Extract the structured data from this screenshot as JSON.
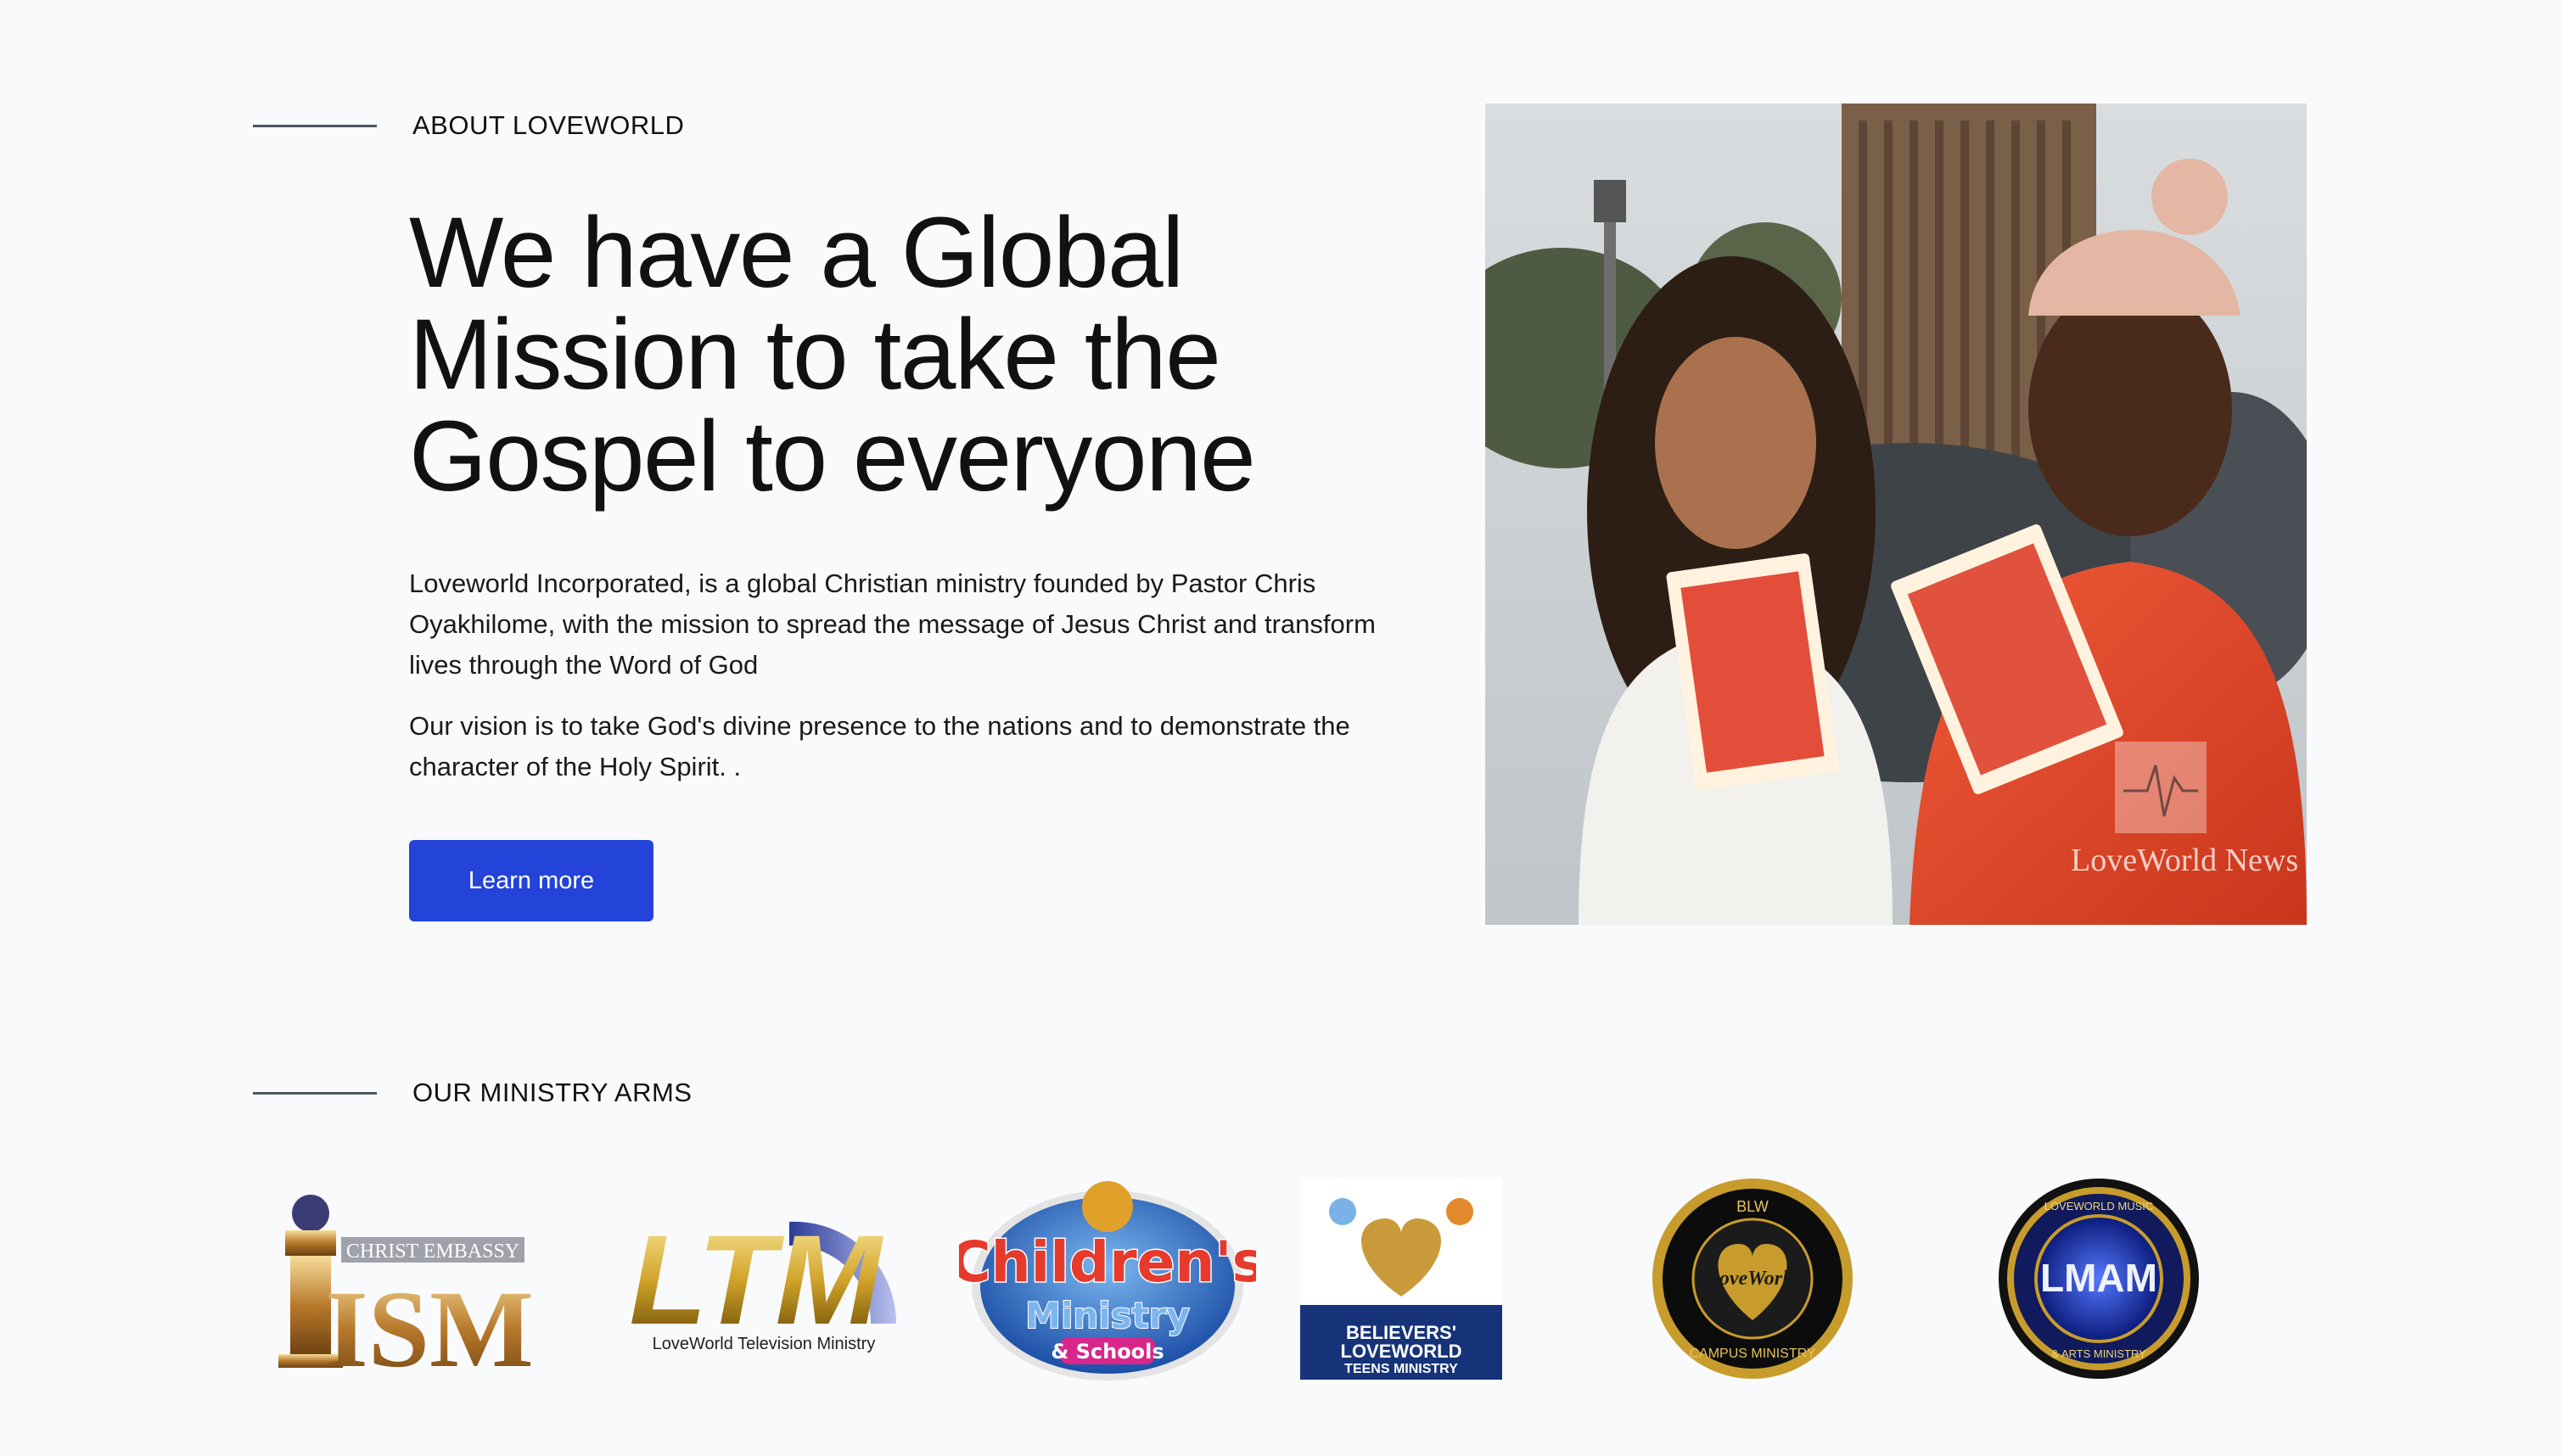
{
  "about": {
    "eyebrow": "ABOUT LOVEWORLD",
    "headline": "We have a Global Mission to take the Gospel to everyone",
    "paragraph1": "Loveworld Incorporated, is a global Christian ministry founded by Pastor Chris Oyakhilome, with the mission to spread the message of Jesus Christ and transform lives through the Word of God",
    "paragraph2": "Our vision is to take God's divine presence to the nations and to demonstrate the character of the Holy Spirit. .",
    "button_label": "Learn more",
    "button_color": "#2443d9",
    "photo": {
      "description": "two young women smiling holding Rhapsody of Realities booklets",
      "watermark": "LoveWorld News"
    }
  },
  "ministry_arms": {
    "eyebrow": "OUR MINISTRY ARMS",
    "logos": [
      {
        "name": "ISM",
        "lines": [
          "CHRIST EMBASSY",
          "ISM"
        ]
      },
      {
        "name": "LTM",
        "lines": [
          "LTM",
          "LoveWorld Television Ministry"
        ]
      },
      {
        "name": "Children's Ministry & Schools",
        "lines": [
          "Children's",
          "Ministry",
          "& Schools"
        ]
      },
      {
        "name": "Believers' LoveWorld Teens Ministry",
        "lines": [
          "BELIEVERS'",
          "LOVEWORLD",
          "TEENS MINISTRY"
        ]
      },
      {
        "name": "BLW Campus Ministry",
        "lines": [
          "BLW",
          "LoveWorld",
          "CAMPUS MINISTRY"
        ]
      },
      {
        "name": "LMAM",
        "lines": [
          "LOVEWORLD MUSIC",
          "LMAM",
          "& ARTS MINISTRY"
        ]
      }
    ]
  }
}
